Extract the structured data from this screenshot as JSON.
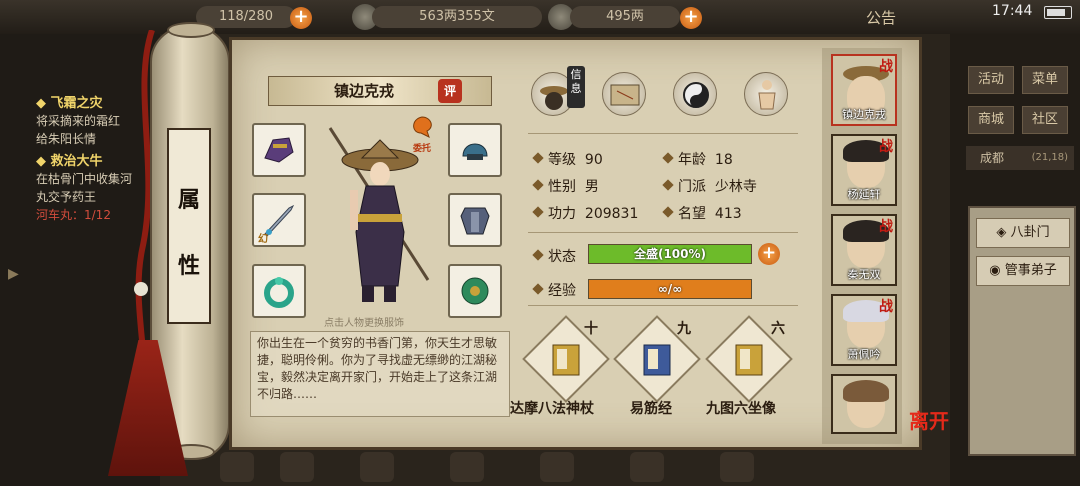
{
  "topbar": {
    "capacity_text": "118/280",
    "copper_text": "563两355文",
    "silver_text": "495两",
    "notice_label": "公告",
    "time": "17:44"
  },
  "quests": [
    {
      "title": "飞霜之灾",
      "lines": [
        "将采摘来的霜红",
        "给朱阳长情"
      ]
    },
    {
      "title": "救治大牛",
      "lines": [
        "在枯骨门中收集河",
        "丸交予药王"
      ],
      "progress": "河车丸：1/12"
    }
  ],
  "right_menu": {
    "buttons": [
      "活动",
      "菜单",
      "商城",
      "社区"
    ],
    "city": "成都",
    "city_coord": "(21,18)",
    "side_buttons": [
      "八卦门",
      "管事弟子"
    ]
  },
  "scroll": {
    "attribute_chars": [
      "属",
      "性"
    ]
  },
  "character": {
    "name": "镇边克戎",
    "ping_label": "评",
    "delegate_label": "委托",
    "equip_tag": "幻",
    "change_hint": "点击人物更换服饰",
    "bio": "你出生在一个贫穷的书香门第，你天生才思敏捷，聪明伶俐。你为了寻找虚无缥缈的江湖秘宝，毅然决定离开家门，开始走上了这条江湖不归路……",
    "info_tag": "信息",
    "stats": {
      "level_label": "等级",
      "level": "90",
      "age_label": "年龄",
      "age": "18",
      "gender_label": "性别",
      "gender": "男",
      "school_label": "门派",
      "school": "少林寺",
      "power_label": "功力",
      "power": "209831",
      "fame_label": "名望",
      "fame": "413"
    },
    "status_label": "状态",
    "status_text": "全盛(100%)",
    "status_fill": 1.0,
    "exp_label": "经验",
    "exp_text": "∞/∞",
    "exp_fill": 1.0,
    "skills": [
      {
        "num": "十",
        "name": "达摩八法神杖"
      },
      {
        "num": "九",
        "name": "易筋经"
      },
      {
        "num": "六",
        "name": "九图六坐像"
      }
    ]
  },
  "roster": [
    {
      "name": "镇边克戎",
      "mark": "战"
    },
    {
      "name": "杨延轩",
      "mark": "战"
    },
    {
      "name": "秦无双",
      "mark": "战"
    },
    {
      "name": "萧佩吟",
      "mark": "战"
    },
    {
      "name": "",
      "mark": ""
    }
  ],
  "leave_label": "离开",
  "colors": {
    "status_green": "#6dbb2a",
    "exp_orange": "#e07e1c",
    "accent_red": "#b8321f"
  }
}
